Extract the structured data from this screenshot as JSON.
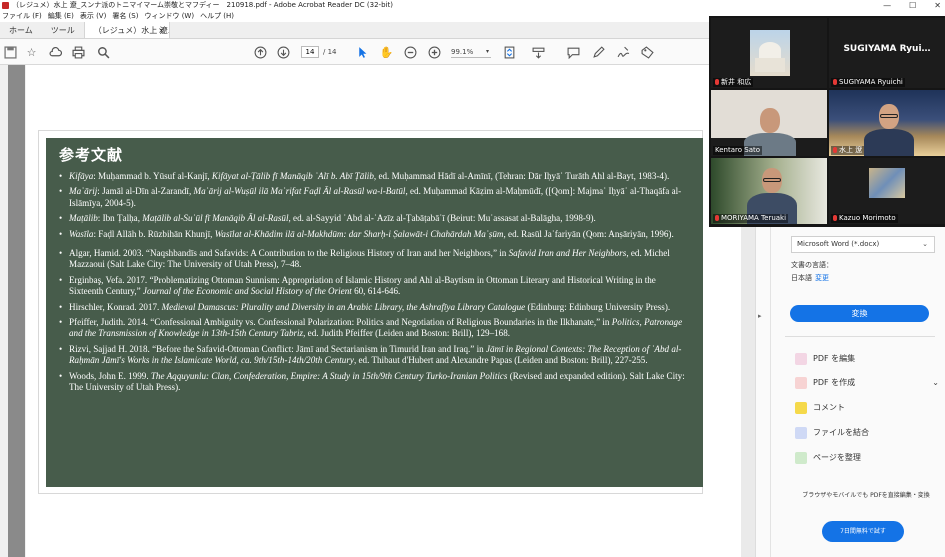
{
  "window": {
    "title": "（レジュメ）水上 遼_スンナ派のトニマイマーム崇敬とマフディー　210918.pdf - Adobe Acrobat Reader DC (32-bit)",
    "controls": [
      "—",
      "☐",
      "✕"
    ]
  },
  "menu": [
    "ファイル (F)",
    "編集 (E)",
    "表示 (V)",
    "署名 (S)",
    "ウィンドウ (W)",
    "ヘルプ (H)"
  ],
  "tabs": {
    "home": "ホーム",
    "tools": "ツール",
    "doc": "（レジュメ）水上 遼…",
    "close": "×"
  },
  "toolbar": {
    "page_current": "14",
    "page_total": "/ 14",
    "zoom": "99.1%"
  },
  "slide": {
    "title": "参考文献",
    "refs": [
      {
        "a": "Kifāya",
        "b": ": Muḥammad b. Yūsuf al-Kanjī, ",
        "c": "Kifāyat al-Ṭālib fī Manāqib ʿAlī b. Abī Ṭālib",
        "d": ", ed. Muḥammad Hādī al-Amīnī, (Tehran: Dār Iḥyāʾ Turāth Ahl al-Bayt, 1983-4)."
      },
      {
        "a": "Maʿārij",
        "b": ": Jamāl al-Dīn al-Zarandī, ",
        "c": "Maʿārij al-Wuṣūl ilā Maʿrifat Faḍl Āl al-Rasūl wa-l-Batūl",
        "d": ", ed. Muḥammad Kāẓim al-Maḥmūdī, ([Qom]: Majmaʿ Iḥyāʾ al-Thaqāfa al-Islāmīya, 2004-5)."
      },
      {
        "a": "Maṭālib",
        "b": ": Ibn Ṭalḥa, ",
        "c": "Maṭālib al-Suʾūl fī Manāqib Āl al-Rasūl",
        "d": ", ed. al-Sayyid ʿAbd al-ʿAzīz al-Ṭabāṭabāʾī (Beirut: Muʾassasat al-Balāgha, 1998-9)."
      },
      {
        "a": "Wasīla",
        "b": ": Faḍl Allāh b. Rūzbihān Khunjī, ",
        "c": "Wasīlat al-Khādim ilā al-Makhdūm: dar Sharḥ-i Ṣalawāt-i Chahārdah Maʿṣūm",
        "d": ", ed. Rasūl Jaʿfariyān (Qom: Anṣāriyān, 1996)."
      },
      {
        "a": "",
        "b": "Algar, Hamid. 2003. “Naqshbandīs and Safavids: A Contribution to the Religious History of Iran and her Neighbors,” in ",
        "c": "Safavid Iran and Her Neighbors",
        "d": ", ed. Michel Mazzaoui (Salt Lake City: The University of Utah Press), 7–48."
      },
      {
        "a": "",
        "b": "Erginbaş, Vefa. 2017. “Problematizing Ottoman Sunnism: Appropriation of Islamic History and Ahl al-Baytism in Ottoman Literary and Historical Writing in the Sixteenth Century,” ",
        "c": "Journal of the Economic and Social History of the Orient",
        "d": " 60, 614-646."
      },
      {
        "a": "",
        "b": "Hirschler, Konrad. 2017. ",
        "c": "Medieval Damascus: Plurality and Diversity in an Arabic Library, the Ashrafīya Library Catalogue",
        "d": " (Edinburg: Edinburg University Press)."
      },
      {
        "a": "",
        "b": "Pfeiffer, Judith. 2014. “Confessional Ambiguity vs. Confessional Polarization: Politics and Negotiation of Religious Boundaries in the Ilkhanate,” in ",
        "c": "Politics, Patronage and the Transmission of Knowledge in 13th-15th Century Tabriz",
        "d": ", ed. Judith Pfeiffer (Leiden and Boston: Brill), 129–168."
      },
      {
        "a": "",
        "b": "Rizvi, Sajjad H. 2018. “Before the Safavid-Ottoman Conflict: Jāmī and Sectarianism in Timurid Iran and Iraq.” in ",
        "c": "Jāmī in Regional Contexts: The Reception of ʿAbd al-Raḥmān Jāmī's Works in the Islamicate World, ca. 9th/15th-14th/20th Century",
        "d": ", ed. Thibaut d'Hubert and Alexandre Papas (Leiden and Boston: Brill), 227-255."
      },
      {
        "a": "",
        "b": "Woods, John E. 1999. ",
        "c": "The Aqquyunlu: Clan, Confederation, Empire: A Study in 15th/9th Century Turko-Iranian Politics",
        "d": " (Revised and expanded edition). Salt Lake City: The University of Utah Press)."
      }
    ]
  },
  "right_panel": {
    "convert_value": "Microsoft Word (*.docx)",
    "lang_label": "文書の言語：",
    "lang_value": "日本語",
    "lang_change": "変更",
    "convert_button": "変換",
    "tools": [
      "PDF を編集",
      "PDF を作成",
      "コメント",
      "ファイルを結合",
      "ページを整理"
    ],
    "promo": "ブラウザやモバイルでも PDFを直接編集・変換",
    "trial_button": "7日間無料で試す"
  },
  "zoom": {
    "participants": [
      {
        "name": "新井 和広",
        "muted": true
      },
      {
        "name": "SUGIYAMA Ryuichi",
        "muted": true,
        "display": "SUGIYAMA  Ryui…"
      },
      {
        "name": "Kentaro Sato",
        "muted": false
      },
      {
        "name": "水上 遼",
        "muted": true
      },
      {
        "name": "MORIYAMA Teruaki",
        "muted": true
      },
      {
        "name": "Kazuo Morimoto",
        "muted": true
      }
    ]
  },
  "colors": {
    "slide_bg": "#475c4b",
    "accent": "#1473e6",
    "active_speaker": "#e3d26a"
  }
}
